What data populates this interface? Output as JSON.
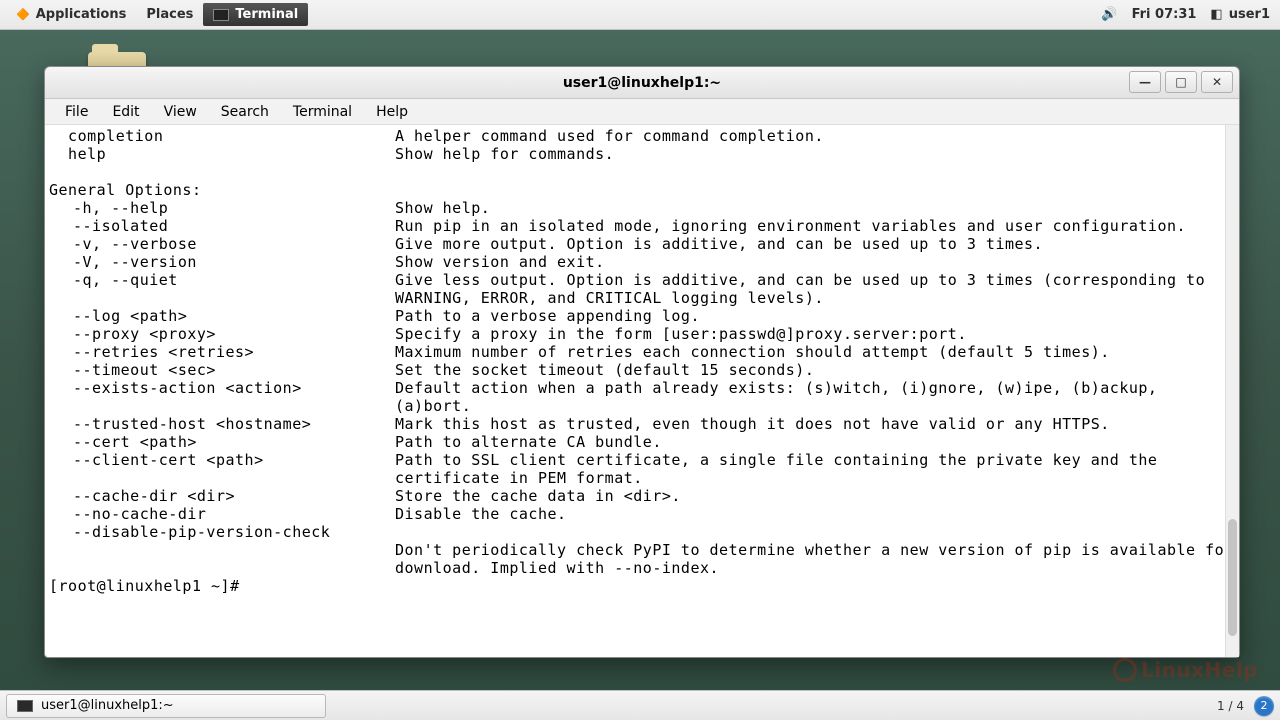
{
  "top_panel": {
    "applications": "Applications",
    "places": "Places",
    "active_app": "Terminal",
    "clock": "Fri 07:31",
    "user": "user1"
  },
  "window": {
    "title": "user1@linuxhelp1:~",
    "minimize": "—",
    "maximize": "□",
    "close": "✕"
  },
  "menu": {
    "file": "File",
    "edit": "Edit",
    "view": "View",
    "search": "Search",
    "terminal": "Terminal",
    "help": "Help"
  },
  "commands": [
    {
      "flag": "  completion",
      "desc": "A helper command used for command completion."
    },
    {
      "flag": "  help",
      "desc": "Show help for commands."
    }
  ],
  "section_header": "General Options:",
  "options": [
    {
      "flag": "-h, --help",
      "desc": "Show help."
    },
    {
      "flag": "--isolated",
      "desc": "Run pip in an isolated mode, ignoring environment variables and user configuration."
    },
    {
      "flag": "-v, --verbose",
      "desc": "Give more output. Option is additive, and can be used up to 3 times."
    },
    {
      "flag": "-V, --version",
      "desc": "Show version and exit."
    },
    {
      "flag": "-q, --quiet",
      "desc": "Give less output. Option is additive, and can be used up to 3 times (corresponding to WARNING, ERROR, and CRITICAL logging levels)."
    },
    {
      "flag": "--log <path>",
      "desc": "Path to a verbose appending log."
    },
    {
      "flag": "--proxy <proxy>",
      "desc": "Specify a proxy in the form [user:passwd@]proxy.server:port."
    },
    {
      "flag": "--retries <retries>",
      "desc": "Maximum number of retries each connection should attempt (default 5 times)."
    },
    {
      "flag": "--timeout <sec>",
      "desc": "Set the socket timeout (default 15 seconds)."
    },
    {
      "flag": "--exists-action <action>",
      "desc": "Default action when a path already exists: (s)witch, (i)gnore, (w)ipe, (b)ackup, (a)bort."
    },
    {
      "flag": "--trusted-host <hostname>",
      "desc": "Mark this host as trusted, even though it does not have valid or any HTTPS."
    },
    {
      "flag": "--cert <path>",
      "desc": "Path to alternate CA bundle."
    },
    {
      "flag": "--client-cert <path>",
      "desc": "Path to SSL client certificate, a single file containing the private key and the certificate in PEM format."
    },
    {
      "flag": "--cache-dir <dir>",
      "desc": "Store the cache data in <dir>."
    },
    {
      "flag": "--no-cache-dir",
      "desc": "Disable the cache."
    },
    {
      "flag": "--disable-pip-version-check",
      "desc": ""
    }
  ],
  "trailing_desc": "Don't periodically check PyPI to determine whether a new version of pip is available for download. Implied with --no-index.",
  "prompt": "[root@linuxhelp1 ~]# ",
  "taskbar": {
    "item": "user1@linuxhelp1:~",
    "workspace": "1 / 4",
    "ws_current": "2"
  },
  "watermark": "LinuxHelp"
}
